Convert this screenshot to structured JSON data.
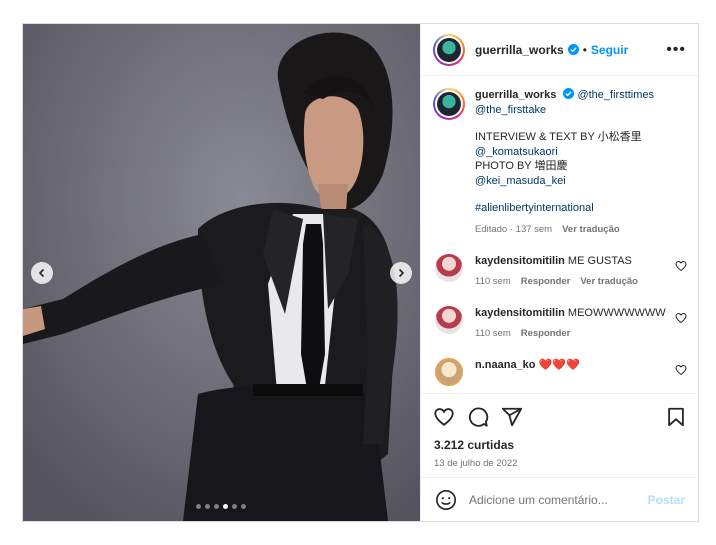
{
  "header": {
    "username": "guerrilla_works",
    "separator": "•",
    "follow_label": "Seguir",
    "more_label": "•••"
  },
  "caption": {
    "username": "guerrilla_works",
    "line1_mention": "@the_firsttimes",
    "line2_mention": "@the_firsttake",
    "interview_label": "INTERVIEW & TEXT BY 小松香里",
    "interview_mention": "@_komatsukaori",
    "photo_label": "PHOTO BY 増田慶",
    "photo_mention": "@kei_masuda_kei",
    "hashtag": "#alienlibertyinternational",
    "edited": "Editado · 137 sem",
    "translate": "Ver tradução"
  },
  "comments": [
    {
      "username": "kaydensitomitilin",
      "text": "ME GUSTAS",
      "time": "110 sem",
      "reply": "Responder",
      "translate": "Ver tradução"
    },
    {
      "username": "kaydensitomitilin",
      "text": "MEOWWWWWWW",
      "time": "110 sem",
      "reply": "Responder"
    },
    {
      "username": "n.naana_ko",
      "text": "❤️❤️❤️"
    }
  ],
  "actions": {
    "likes": "3.212 curtidas",
    "date": "13 de julho de 2022"
  },
  "composer": {
    "placeholder": "Adicione um comentário...",
    "post_label": "Postar"
  },
  "carousel": {
    "slides": 6,
    "active_index": 3
  },
  "colors": {
    "accent": "#0095f6",
    "link": "#00376b",
    "muted": "#737373"
  }
}
